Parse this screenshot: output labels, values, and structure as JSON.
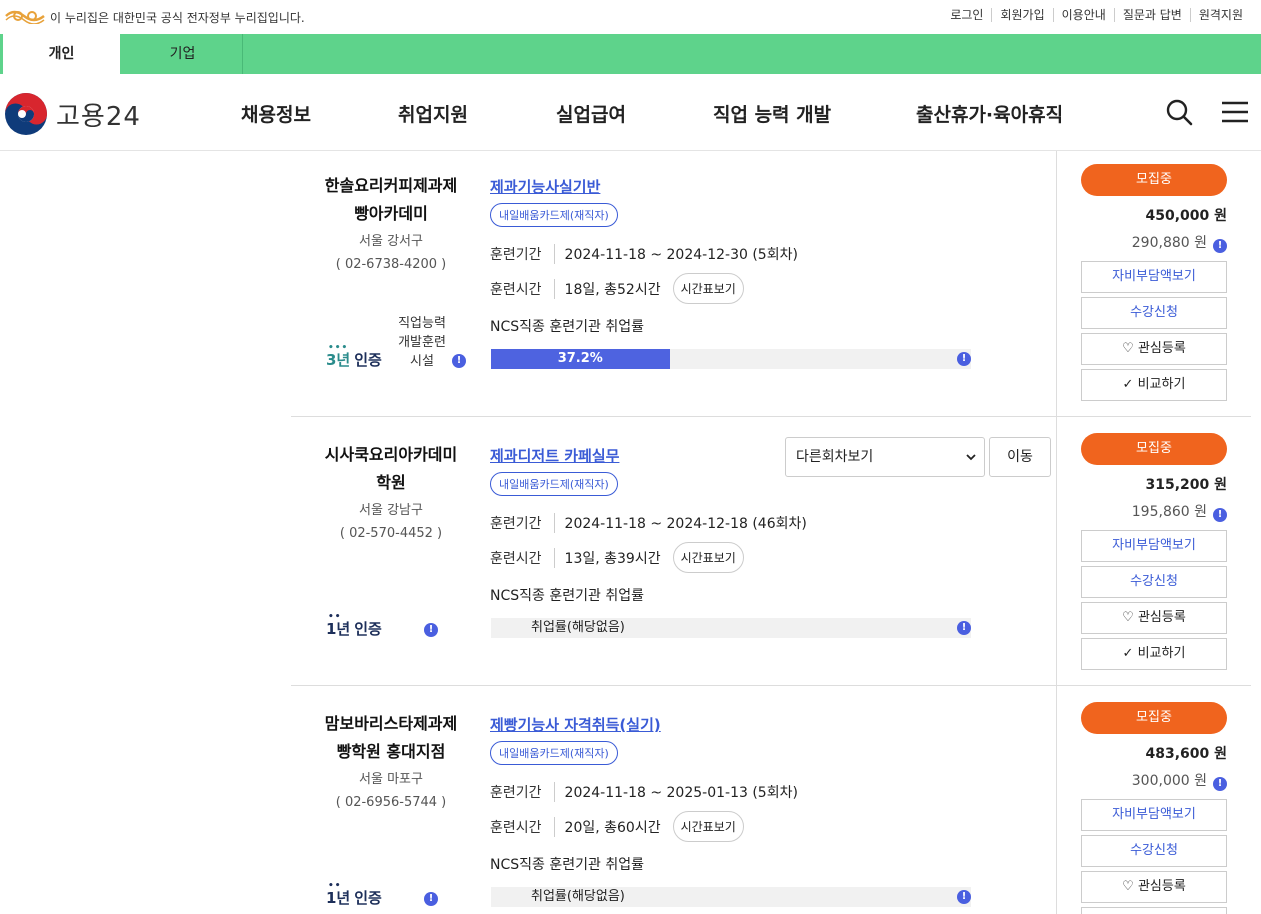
{
  "topbar": {
    "notice": "이 누리집은 대한민국 공식 전자정부 누리집입니다.",
    "links": [
      "로그인",
      "회원가입",
      "이용안내",
      "질문과 답변",
      "원격지원"
    ]
  },
  "audience_tabs": [
    "개인",
    "기업"
  ],
  "header": {
    "brand": "고용24",
    "nav": [
      "채용정보",
      "취업지원",
      "실업급여",
      "직업 능력 개발",
      "출산휴가·육아휴직"
    ]
  },
  "colors": {
    "accent_green": "#5ed38b",
    "recruit_orange": "#f0641e",
    "link_blue": "#3a5bd6",
    "bar_blue": "#4e63e0"
  },
  "common": {
    "period_label": "훈련기간",
    "time_label": "훈련시간",
    "timetable_btn": "시간표보기",
    "ncs_label": "NCS직종 훈련기관 취업률",
    "recruit": "모집중",
    "self_pay_btn": "자비부담액보기",
    "apply_btn": "수강신청",
    "interest_btn": "관심등록",
    "compare_btn": "비교하기",
    "cert_suffix": "인증",
    "info_glyph": "!",
    "select_placeholder": "다른회차보기",
    "move_btn": "이동"
  },
  "courses": [
    {
      "inst_name_1": "한솔요리커피제과제",
      "inst_name_2": "빵아카데미",
      "area": "서울 강서구",
      "tel": "( 02-6738-4200 )",
      "cert_years": "3년",
      "cert_sub": "직업능력 개발훈련 시설",
      "title": "제과기능사실기반",
      "tag": "내일배움카드제(재직자)",
      "period": "2024-11-18 ~ 2024-12-30 (5회차)",
      "time": "18일, 총52시간",
      "employment_rate": 37.2,
      "employment_text": "37.2%",
      "price": "450,000 원",
      "self_price": "290,880 원"
    },
    {
      "inst_name_1": "시사쿡요리아카데미",
      "inst_name_2": "학원",
      "area": "서울 강남구",
      "tel": "( 02-570-4452 )",
      "cert_years": "1년",
      "title": "제과디저트 카페실무",
      "tag": "내일배움카드제(재직자)",
      "period": "2024-11-18 ~ 2024-12-18 (46회차)",
      "time": "13일, 총39시간",
      "employment_text": "취업률(해당없음)",
      "price": "315,200 원",
      "self_price": "195,860 원"
    },
    {
      "inst_name_1": "맘보바리스타제과제",
      "inst_name_2": "빵학원 홍대지점",
      "area": "서울 마포구",
      "tel": "( 02-6956-5744 )",
      "cert_years": "1년",
      "title": "제빵기능사 자격취득(실기)",
      "tag": "내일배움카드제(재직자)",
      "period": "2024-11-18 ~ 2025-01-13 (5회차)",
      "time": "20일, 총60시간",
      "employment_text": "취업률(해당없음)",
      "price": "483,600 원",
      "self_price": "300,000 원"
    }
  ]
}
